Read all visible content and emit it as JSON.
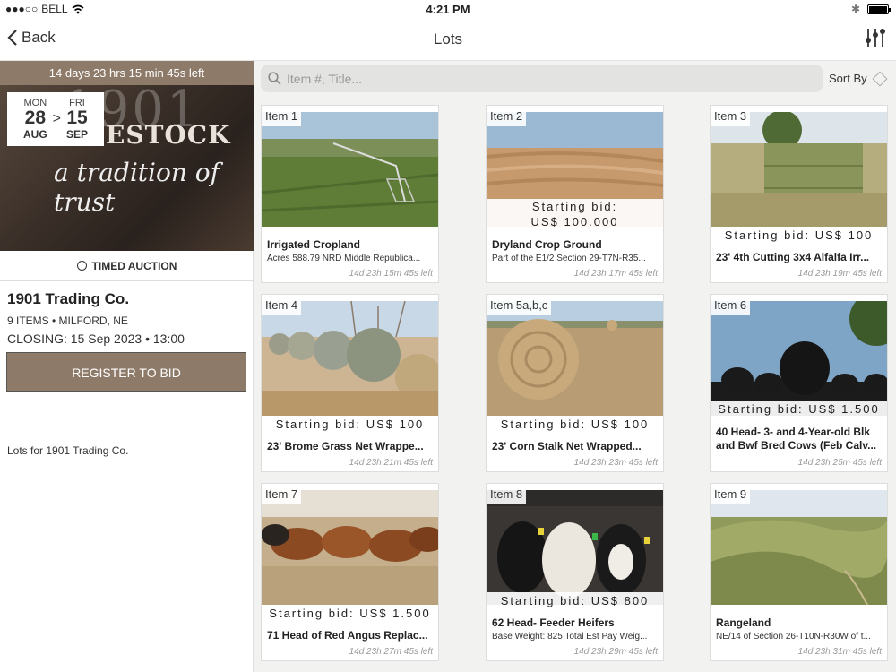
{
  "status": {
    "carrier": "BELL",
    "time": "4:21 PM"
  },
  "nav": {
    "back_label": "Back",
    "title": "Lots"
  },
  "auction": {
    "countdown": "14 days 23 hrs 15 min 45s left",
    "start": {
      "dow": "MON",
      "day": "28",
      "mon": "AUG"
    },
    "end": {
      "dow": "FRI",
      "day": "15",
      "mon": "SEP"
    },
    "arrow": ">",
    "hero_big": "1901",
    "hero_brand": "ESTOCK",
    "hero_script": "a tradition of trust",
    "type_label": "TIMED AUCTION",
    "company": "1901 Trading Co.",
    "meta": "9 ITEMS • MILFORD, NE",
    "closing": "CLOSING: 15 Sep 2023 • 13:00",
    "register_label": "REGISTER TO BID",
    "lots_for": "Lots for 1901 Trading Co."
  },
  "search": {
    "placeholder": "Item #, Title..."
  },
  "sort": {
    "label": "Sort By"
  },
  "lots": [
    {
      "tag": "Item 1",
      "bid": "",
      "title": "Irrigated Cropland",
      "sub": "Acres 588.79 NRD Middle Republica...",
      "time": "14d 23h 15m 45s left"
    },
    {
      "tag": "Item 2",
      "bid": "Starting bid: US$ 100.000",
      "title": "Dryland Crop Ground",
      "sub": "Part of the E1/2 Section 29-T7N-R35...",
      "time": "14d 23h 17m 45s left"
    },
    {
      "tag": "Item 3",
      "bid": "Starting bid: US$ 100",
      "title": "23' 4th Cutting 3x4 Alfalfa Irr...",
      "sub": "",
      "time": "14d 23h 19m 45s left"
    },
    {
      "tag": "Item 4",
      "bid": "Starting bid: US$ 100",
      "title": "23' Brome Grass Net Wrappe...",
      "sub": "",
      "time": "14d 23h 21m 45s left"
    },
    {
      "tag": "Item 5a,b,c",
      "bid": "Starting bid: US$ 100",
      "title": "23' Corn Stalk Net Wrapped...",
      "sub": "",
      "time": "14d 23h 23m 45s left"
    },
    {
      "tag": "Item 6",
      "bid": "Starting bid: US$ 1.500",
      "title": "40 Head- 3- and 4-Year-old Blk and Bwf Bred Cows (Feb Calv...",
      "sub": "",
      "time": "14d 23h 25m 45s left"
    },
    {
      "tag": "Item 7",
      "bid": "Starting bid: US$ 1.500",
      "title": "71 Head of Red Angus Replac...",
      "sub": "",
      "time": "14d 23h 27m 45s left"
    },
    {
      "tag": "Item 8",
      "bid": "Starting bid: US$ 800",
      "title": "62 Head- Feeder Heifers",
      "sub": "Base Weight: 825 Total Est Pay Weig...",
      "time": "14d 23h 29m 45s left"
    },
    {
      "tag": "Item 9",
      "bid": "",
      "title": "Rangeland",
      "sub": "NE/14 of Section 26-T10N-R30W of t...",
      "time": "14d 23h 31m 45s left"
    }
  ]
}
